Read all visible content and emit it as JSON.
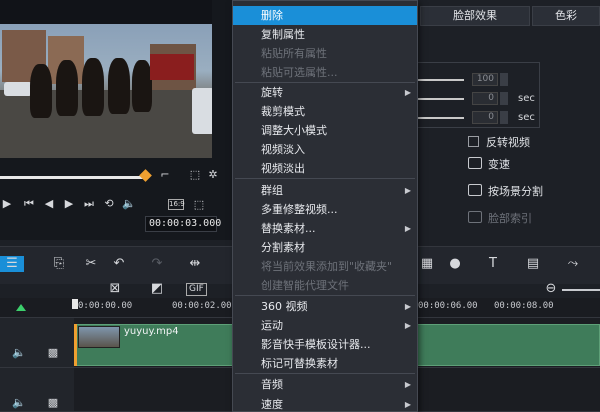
{
  "preview": {
    "timecode": "00:00:03.000",
    "ratio_label": "16:9"
  },
  "right_panel": {
    "tab_face": "脸部效果",
    "tab_color": "色彩",
    "field1_value": "100",
    "field2_value": "0",
    "field3_value": "0",
    "unit_sec": "sec",
    "reverse_video": "反转视频",
    "speed_change": "变速",
    "split_by_scene": "按场景分割",
    "face_index": "脸部索引"
  },
  "timeline": {
    "ticks": [
      "0:00:00.00",
      "00:00:02.00",
      "00:00:06.00",
      "00:00:08.00"
    ],
    "clip_name": "yuyuy.mp4",
    "gif_label": "GIF"
  },
  "menu": {
    "items": [
      {
        "label": "删除",
        "state": "highlighted"
      },
      {
        "label": "复制属性",
        "state": "normal"
      },
      {
        "label": "粘贴所有属性",
        "state": "disabled"
      },
      {
        "label": "粘贴可选属性...",
        "state": "disabled"
      },
      {
        "label": "旋转",
        "state": "submenu"
      },
      {
        "label": "裁剪模式",
        "state": "normal"
      },
      {
        "label": "调整大小模式",
        "state": "normal"
      },
      {
        "label": "视频淡入",
        "state": "normal"
      },
      {
        "label": "视频淡出",
        "state": "normal"
      },
      {
        "label": "群组",
        "state": "submenu"
      },
      {
        "label": "多重修整视频...",
        "state": "normal"
      },
      {
        "label": "替换素材...",
        "state": "submenu"
      },
      {
        "label": "分割素材",
        "state": "normal"
      },
      {
        "label": "将当前效果添加到\"收藏夹\"",
        "state": "disabled"
      },
      {
        "label": "创建智能代理文件",
        "state": "disabled"
      },
      {
        "label": "360 视频",
        "state": "submenu"
      },
      {
        "label": "运动",
        "state": "submenu"
      },
      {
        "label": "影音快手模板设计器...",
        "state": "normal"
      },
      {
        "label": "标记可替换素材",
        "state": "normal"
      },
      {
        "label": "音频",
        "state": "submenu"
      },
      {
        "label": "速度",
        "state": "submenu"
      }
    ]
  },
  "colors": {
    "highlight": "#1a8fd8",
    "clip_green": "#3f7c5a",
    "scrub_marker": "#f0a030"
  }
}
